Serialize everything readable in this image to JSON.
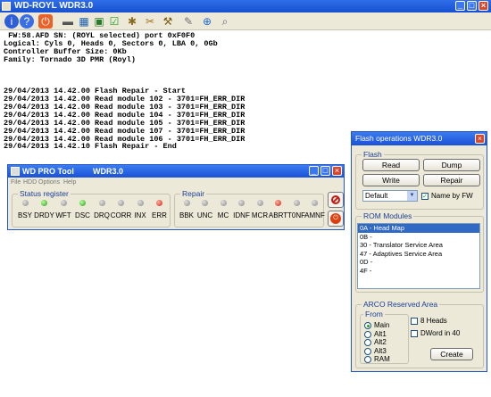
{
  "main_window": {
    "title": "WD-ROYL WDR3.0"
  },
  "toolbar": {
    "icons": [
      "info-icon",
      "help-icon",
      "stop-icon",
      "drive-icon",
      "table-icon",
      "chip-icon",
      "check-icon",
      "settings-icon",
      "tools-icon",
      "hammer-icon",
      "repair-icon",
      "zoom-icon",
      "search-icon"
    ]
  },
  "log": {
    "lines": [
      " FW:58.AFD SN: (ROYL selected) port 0xF0F0",
      "Logical: Cyls 0, Heads 0, Sectors 0, LBA 0, 0Gb",
      "Controller Buffer Size: 0Kb",
      "Family: Tornado 3D PMR (Royl)",
      "",
      "",
      "",
      "29/04/2013 14.42.00 Flash Repair - Start",
      "29/04/2013 14.42.00 Read module 102 - 3701=FH_ERR_DIR",
      "29/04/2013 14.42.00 Read module 103 - 3701=FH_ERR_DIR",
      "29/04/2013 14.42.00 Read module 104 - 3701=FH_ERR_DIR",
      "29/04/2013 14.42.00 Read module 105 - 3701=FH_ERR_DIR",
      "29/04/2013 14.42.00 Read module 107 - 3701=FH_ERR_DIR",
      "29/04/2013 14.42.00 Read module 106 - 3701=FH_ERR_DIR",
      "29/04/2013 14.42.10 Flash Repair - End"
    ]
  },
  "pro_tool": {
    "title": "WD PRO Tool",
    "subtitle": "WDR3.0",
    "menu": [
      "File",
      "HDD",
      "Options",
      "Help"
    ],
    "status_label": "Status register",
    "repair_label": "Repair",
    "status_leds": [
      {
        "label": "BSY",
        "state": "off"
      },
      {
        "label": "DRDY",
        "state": "green"
      },
      {
        "label": "WFT",
        "state": "off"
      },
      {
        "label": "DSC",
        "state": "green"
      },
      {
        "label": "DRQ",
        "state": "off"
      },
      {
        "label": "CORR",
        "state": "off"
      },
      {
        "label": "INX",
        "state": "off"
      },
      {
        "label": "ERR",
        "state": "red"
      }
    ],
    "repair_leds": [
      {
        "label": "BBK",
        "state": "off"
      },
      {
        "label": "UNC",
        "state": "off"
      },
      {
        "label": "MC",
        "state": "off"
      },
      {
        "label": "IDNF",
        "state": "off"
      },
      {
        "label": "MCR",
        "state": "off"
      },
      {
        "label": "ABRT",
        "state": "red"
      },
      {
        "label": "T0NF",
        "state": "off"
      },
      {
        "label": "AMNF",
        "state": "off"
      }
    ]
  },
  "flash_dialog": {
    "title": "Flash operations WDR3.0",
    "flash_group": "Flash",
    "read": "Read",
    "dump": "Dump",
    "write": "Write",
    "repair": "Repair",
    "combo_value": "Default",
    "name_by_fw": "Name by FW",
    "rom_group": "ROM Modules",
    "rom_items": [
      "0A - Head Map",
      "0B -",
      "30 - Translator Service Area",
      "47 - Adaptives Service Area",
      "0D -",
      "4F -"
    ],
    "arco_group": "ARCO Reserved Area",
    "from_group": "From",
    "from_options": [
      "Main",
      "Alt1",
      "Alt2",
      "Alt3",
      "RAM"
    ],
    "heads8": "8 Heads",
    "dword40": "DWord in 40",
    "create": "Create"
  },
  "colors": {
    "titlebar": "#1f5ad9",
    "led_green": "#2b9b1a",
    "led_red": "#d22010",
    "selection": "#316ac5"
  }
}
